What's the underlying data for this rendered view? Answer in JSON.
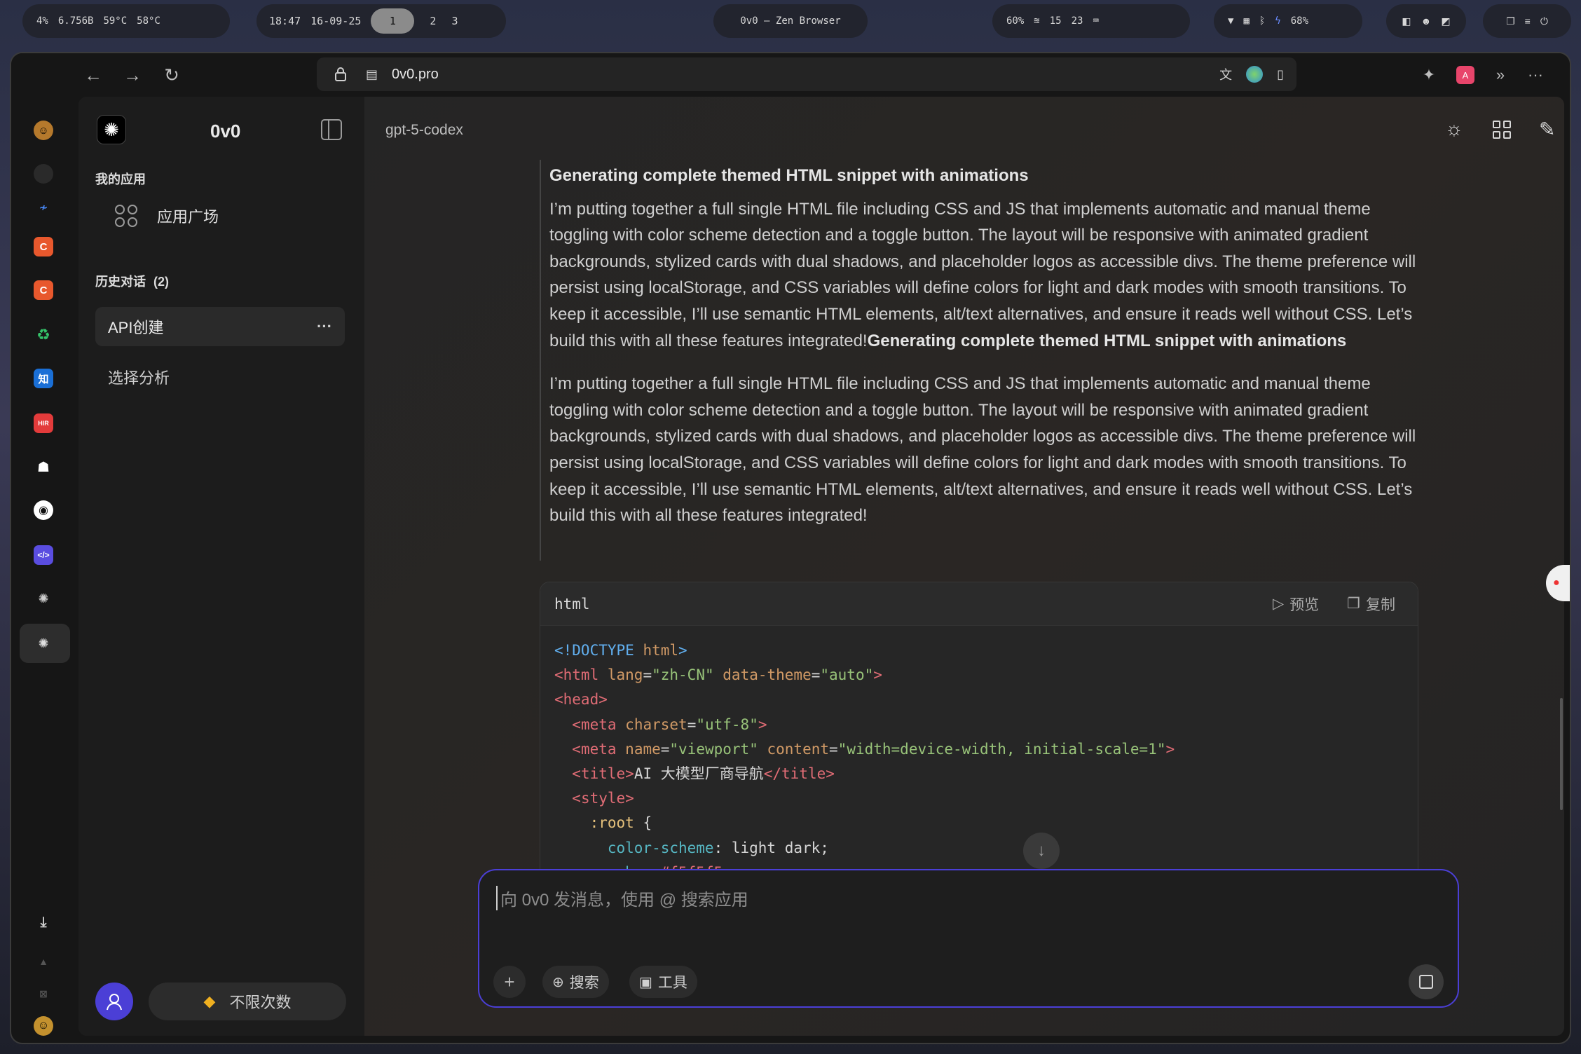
{
  "statusbar": {
    "sys": [
      "4%",
      "6.756B",
      "59°C",
      "58°C"
    ],
    "time": "18:47",
    "date": "16-09-25",
    "workspaces": [
      "1",
      "2",
      "3"
    ],
    "window_title": "0v0 — Zen Browser",
    "indicators": [
      "60%",
      "15",
      "23"
    ],
    "battery": "68%"
  },
  "browser": {
    "url": "0v0.pro"
  },
  "sidebar": {
    "app_name": "0v0",
    "my_apps_heading": "我的应用",
    "app_plaza": "应用广场",
    "history_heading": "历史对话",
    "history_count": "(2)",
    "conversations": [
      "API创建",
      "选择分析"
    ],
    "more": "···",
    "plan_label": "不限次数"
  },
  "main": {
    "model": "gpt-5-codex",
    "section_title": "Generating complete themed HTML snippet with animations",
    "paragraph1": "I’m putting together a full single HTML file including CSS and JS that implements automatic and manual theme toggling with color scheme detection and a toggle button. The layout will be responsive with animated gradient backgrounds, stylized cards with dual shadows, and placeholder logos as accessible divs. The theme preference will persist using localStorage, and CSS variables will define colors for light and dark modes with smooth transitions. To keep it accessible, I’ll use semantic HTML elements, alt/text alternatives, and ensure it reads well without CSS. Let’s build this with all these features integrated!",
    "paragraph1_bold": "Generating complete themed HTML snippet with animations",
    "paragraph2": "I’m putting together a full single HTML file including CSS and JS that implements automatic and manual theme toggling with color scheme detection and a toggle button. The layout will be responsive with animated gradient backgrounds, stylized cards with dual shadows, and placeholder logos as accessible divs. The theme preference will persist using localStorage, and CSS variables will define colors for light and dark modes with smooth transitions. To keep it accessible, I’ll use semantic HTML elements, alt/text alternatives, and ensure it reads well without CSS. Let’s build this with all these features integrated!",
    "code": {
      "lang": "html",
      "preview_label": "预览",
      "copy_label": "复制"
    },
    "input_placeholder": "向 0v0 发消息，使用 @ 搜索应用",
    "search_chip": "搜索",
    "tools_chip": "工具"
  }
}
